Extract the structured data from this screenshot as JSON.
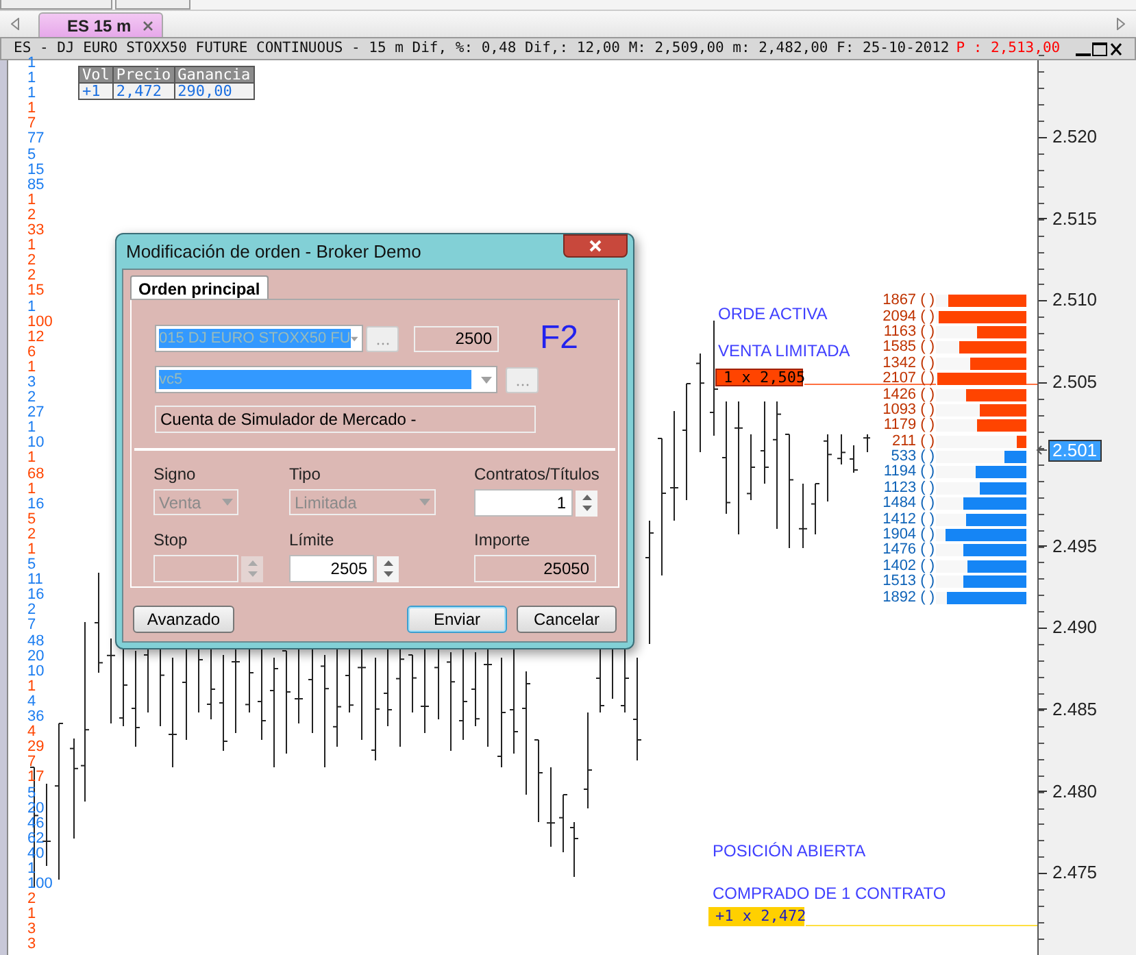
{
  "chart_tab": {
    "label": "ES 15 m",
    "selected": true
  },
  "title_bar": {
    "text": "ES - DJ EURO STOXX50 FUTURE CONTINUOUS -  15 m Dif, %: 0,48 Dif,: 12,00 M: 2,509,00 m: 2,482,00 F: 25-10-2012",
    "last_price": "P : 2,513,00"
  },
  "position_table": {
    "columns": [
      "Vol",
      "Precio",
      "Ganancia"
    ],
    "row": [
      "+1",
      "2,472",
      "290,00"
    ]
  },
  "volume_column": [
    {
      "value": "1",
      "color": "#1a7cf0"
    },
    {
      "value": "1",
      "color": "#1a7cf0"
    },
    {
      "value": "1",
      "color": "#1a7cf0"
    },
    {
      "value": "1",
      "color": "#ff4500"
    },
    {
      "value": "7",
      "color": "#ff4500"
    },
    {
      "value": "77",
      "color": "#1a7cf0"
    },
    {
      "value": "5",
      "color": "#1a7cf0"
    },
    {
      "value": "15",
      "color": "#1a7cf0"
    },
    {
      "value": "85",
      "color": "#1a7cf0"
    },
    {
      "value": "1",
      "color": "#ff4500"
    },
    {
      "value": "2",
      "color": "#ff4500"
    },
    {
      "value": "33",
      "color": "#ff4500"
    },
    {
      "value": "1",
      "color": "#ff4500"
    },
    {
      "value": "2",
      "color": "#ff4500"
    },
    {
      "value": "2",
      "color": "#ff4500"
    },
    {
      "value": "15",
      "color": "#ff4500"
    },
    {
      "value": "1",
      "color": "#1a7cf0"
    },
    {
      "value": "100",
      "color": "#ff4500"
    },
    {
      "value": "12",
      "color": "#ff4500"
    },
    {
      "value": "6",
      "color": "#ff4500"
    },
    {
      "value": "1",
      "color": "#ff4500"
    },
    {
      "value": "3",
      "color": "#1a7cf0"
    },
    {
      "value": "2",
      "color": "#1a7cf0"
    },
    {
      "value": "27",
      "color": "#1a7cf0"
    },
    {
      "value": "1",
      "color": "#1a7cf0"
    },
    {
      "value": "10",
      "color": "#1a7cf0"
    },
    {
      "value": "1",
      "color": "#ff4500"
    },
    {
      "value": "68",
      "color": "#ff4500"
    },
    {
      "value": "1",
      "color": "#ff4500"
    },
    {
      "value": "16",
      "color": "#1a7cf0"
    },
    {
      "value": "5",
      "color": "#ff4500"
    },
    {
      "value": "2",
      "color": "#ff4500"
    },
    {
      "value": "1",
      "color": "#ff4500"
    },
    {
      "value": "5",
      "color": "#1a7cf0"
    },
    {
      "value": "11",
      "color": "#1a7cf0"
    },
    {
      "value": "16",
      "color": "#1a7cf0"
    },
    {
      "value": "2",
      "color": "#1a7cf0"
    },
    {
      "value": "7",
      "color": "#1a7cf0"
    },
    {
      "value": "48",
      "color": "#1a7cf0"
    },
    {
      "value": "20",
      "color": "#1a7cf0"
    },
    {
      "value": "10",
      "color": "#1a7cf0"
    },
    {
      "value": "1",
      "color": "#ff4500"
    },
    {
      "value": "4",
      "color": "#1a7cf0"
    },
    {
      "value": "36",
      "color": "#1a7cf0"
    },
    {
      "value": "4",
      "color": "#ff4500"
    },
    {
      "value": "29",
      "color": "#ff4500"
    },
    {
      "value": "7",
      "color": "#ff4500"
    },
    {
      "value": "17",
      "color": "#ff4500"
    },
    {
      "value": "5",
      "color": "#1a7cf0"
    },
    {
      "value": "20",
      "color": "#1a7cf0"
    },
    {
      "value": "46",
      "color": "#1a7cf0"
    },
    {
      "value": "62",
      "color": "#1a7cf0"
    },
    {
      "value": "40",
      "color": "#1a7cf0"
    },
    {
      "value": "1",
      "color": "#1a7cf0"
    },
    {
      "value": "100",
      "color": "#1a7cf0"
    },
    {
      "value": "2",
      "color": "#ff4500"
    },
    {
      "value": "1",
      "color": "#ff4500"
    },
    {
      "value": "3",
      "color": "#ff4500"
    },
    {
      "value": "3",
      "color": "#ff4500"
    }
  ],
  "axis_labels": [
    "2.520",
    "2.515",
    "2.510",
    "2.505",
    "2.495",
    "2.490",
    "2.485",
    "2.480",
    "2.475"
  ],
  "current_price": "2.501",
  "order_book": [
    {
      "label": "1867 ( )",
      "color": "#ff4400",
      "level": 0.87
    },
    {
      "label": "2094 ( )",
      "color": "#ff4400",
      "level": 0.97
    },
    {
      "label": "1163 ( )",
      "color": "#ff4400",
      "level": 0.54
    },
    {
      "label": "1585 ( )",
      "color": "#ff4400",
      "level": 0.74
    },
    {
      "label": "1342 ( )",
      "color": "#ff4400",
      "level": 0.62
    },
    {
      "label": "2107 ( )",
      "color": "#ff4400",
      "level": 0.98
    },
    {
      "label": "1426 ( )",
      "color": "#ff4400",
      "level": 0.66
    },
    {
      "label": "1093 ( )",
      "color": "#ff4400",
      "level": 0.51
    },
    {
      "label": "1179 ( )",
      "color": "#ff4400",
      "level": 0.55
    },
    {
      "label": "211 ( )",
      "color": "#ff4400",
      "level": 0.1
    },
    {
      "label": "533 ( )",
      "color": "#1585f5",
      "level": 0.25
    },
    {
      "label": "1194 ( )",
      "color": "#1585f5",
      "level": 0.56
    },
    {
      "label": "1123 ( )",
      "color": "#1585f5",
      "level": 0.52
    },
    {
      "label": "1484 ( )",
      "color": "#1585f5",
      "level": 0.69
    },
    {
      "label": "1412 ( )",
      "color": "#1585f5",
      "level": 0.66
    },
    {
      "label": "1904 ( )",
      "color": "#1585f5",
      "level": 0.89
    },
    {
      "label": "1476 ( )",
      "color": "#1585f5",
      "level": 0.69
    },
    {
      "label": "1402 ( )",
      "color": "#1585f5",
      "level": 0.65
    },
    {
      "label": "1513 ( )",
      "color": "#1585f5",
      "level": 0.7
    },
    {
      "label": "1892 ( )",
      "color": "#1585f5",
      "level": 0.88
    }
  ],
  "active_order": {
    "title": "ORDE ACTIVA",
    "type": "VENTA LIMITADA",
    "tag": "1 x 2,505"
  },
  "open_position": {
    "title": "POSICIÓN ABIERTA",
    "description": "COMPRADO DE 1 CONTRATO",
    "tag": "+1 x 2,472"
  },
  "dialog": {
    "title": "Modificación de orden - Broker Demo",
    "tabs": [
      {
        "label": "Orden principal",
        "selected": true
      }
    ],
    "instrument": "015 DJ EURO STOXX50 FU",
    "instrument_price": "2500",
    "hotkey": "F2",
    "account": "vc5",
    "account_description": "Cuenta de Simulador de Mercado -",
    "fields": [
      {
        "label": "Signo",
        "kind": "select",
        "value": "Venta",
        "disabled": true
      },
      {
        "label": "Tipo",
        "kind": "select",
        "value": "Limitada",
        "disabled": true
      },
      {
        "label": "Contratos/Títulos",
        "kind": "spin",
        "value": "1",
        "disabled": false
      },
      {
        "label": "Stop",
        "kind": "spin",
        "disabled": true
      },
      {
        "label": "Límite",
        "kind": "spin",
        "value": "2505",
        "disabled": false
      },
      {
        "label": "Importe",
        "kind": "readonly",
        "value": "25050",
        "disabled": true
      }
    ],
    "buttons": [
      {
        "label": "Avanzado",
        "default": false
      },
      {
        "label": "Enviar",
        "default": true
      },
      {
        "label": "Cancelar",
        "default": false
      }
    ]
  }
}
